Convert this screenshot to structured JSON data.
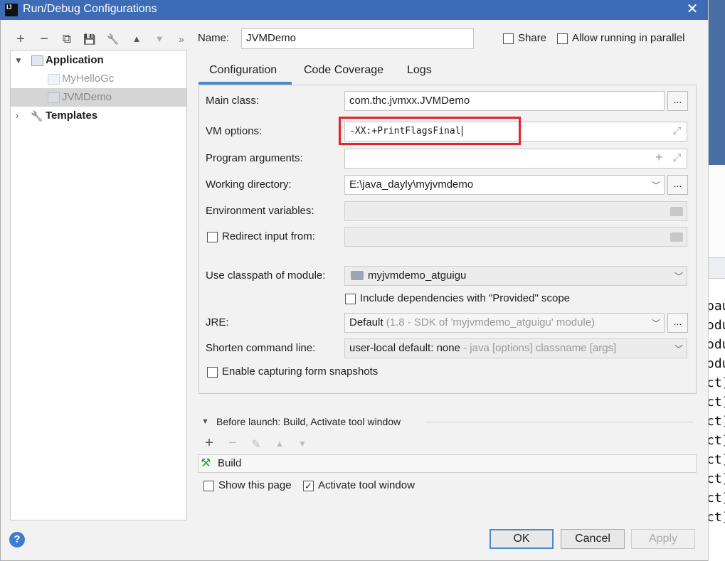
{
  "window": {
    "title": "Run/Debug Configurations",
    "logo_text": "IJ"
  },
  "toolbar": {
    "add": "+",
    "remove": "−",
    "copy": "⧉",
    "save": "💾",
    "edit": "🔧",
    "up": "▲",
    "down": "▼",
    "more": "»"
  },
  "tree": {
    "application": "Application",
    "items": [
      "MyHelloGc",
      "JVMDemo"
    ],
    "templates": "Templates"
  },
  "header": {
    "name_label": "Name:",
    "name_value": "JVMDemo",
    "share_label": "Share",
    "parallel_label": "Allow running in parallel"
  },
  "tabs": [
    "Configuration",
    "Code Coverage",
    "Logs"
  ],
  "form": {
    "main_class_label": "Main class:",
    "main_class_value": "com.thc.jvmxx.JVMDemo",
    "vm_options_label": "VM options:",
    "vm_options_value": "-XX:+PrintFlagsFinal",
    "program_args_label": "Program arguments:",
    "working_dir_label": "Working directory:",
    "working_dir_value": "E:\\java_dayly\\myjvmdemo",
    "env_vars_label": "Environment variables:",
    "redirect_label": "Redirect input from:",
    "classpath_label": "Use classpath of module:",
    "classpath_value": "myjvmdemo_atguigu",
    "include_deps_label": "Include dependencies with \"Provided\" scope",
    "jre_label": "JRE:",
    "jre_value": "Default",
    "jre_hint": "(1.8 - SDK of 'myjvmdemo_atguigu' module)",
    "shorten_label": "Shorten command line:",
    "shorten_value": "user-local default: none",
    "shorten_hint": "- java [options] classname [args]",
    "snapshots_label": "Enable capturing form snapshots",
    "ellipsis": "..."
  },
  "before_launch": {
    "title": "Before launch: Build, Activate tool window",
    "build_item": "Build",
    "show_page_label": "Show this page",
    "activate_label": "Activate tool window"
  },
  "buttons": {
    "ok": "OK",
    "cancel": "Cancel",
    "apply": "Apply",
    "help": "?"
  },
  "background_code": [
    "pau",
    "odu",
    "odu",
    "odu",
    "ct]",
    "ct]",
    "ct]",
    "ct]",
    "ct]",
    "ct]",
    "ct]",
    "ct]"
  ]
}
